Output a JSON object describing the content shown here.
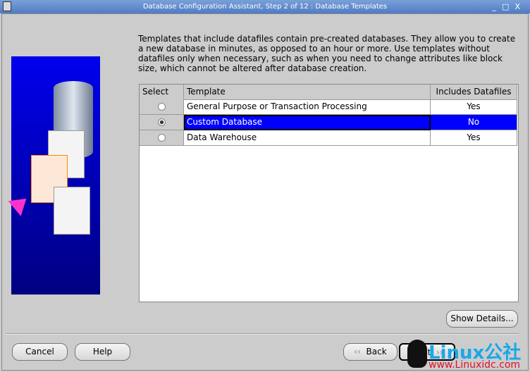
{
  "window": {
    "title": "Database Configuration Assistant, Step 2 of 12 : Database Templates",
    "controls": [
      "_",
      "□",
      "X"
    ]
  },
  "description": "Templates that include datafiles contain pre-created databases. They allow you to create a new database in minutes, as opposed to an hour or more. Use templates without datafiles only when necessary, such as when you need to change attributes like block size, which cannot be altered after database creation.",
  "table": {
    "headers": [
      "Select",
      "Template",
      "Includes Datafiles"
    ],
    "rows": [
      {
        "template": "General Purpose or Transaction Processing",
        "datafiles": "Yes",
        "selected": false
      },
      {
        "template": "Custom Database",
        "datafiles": "No",
        "selected": true
      },
      {
        "template": "Data Warehouse",
        "datafiles": "Yes",
        "selected": false
      }
    ]
  },
  "buttons": {
    "show_details": "Show Details...",
    "cancel": "Cancel",
    "help": "Help",
    "back": "Back",
    "next": "Next"
  },
  "watermark": {
    "brand": "Linux公社",
    "url": "www.Linuxidc.com"
  }
}
